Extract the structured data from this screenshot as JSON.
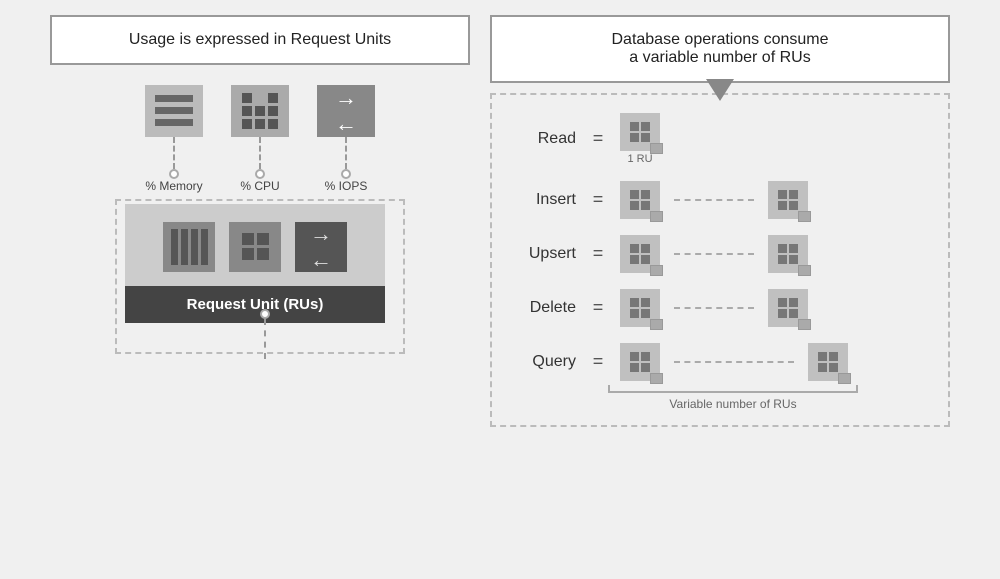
{
  "left": {
    "header": "Usage is expressed in Request Units",
    "resources": [
      {
        "id": "memory",
        "label": "% Memory"
      },
      {
        "id": "cpu",
        "label": "% CPU"
      },
      {
        "id": "iops",
        "label": "% IOPS"
      }
    ],
    "ru_label": "Request Unit (RUs)"
  },
  "right": {
    "header_line1": "Database operations consume",
    "header_line2": "a variable number of RUs",
    "operations": [
      {
        "id": "read",
        "label": "Read",
        "eq": "=",
        "units": 1,
        "ru_label": "1 RU",
        "variable": false
      },
      {
        "id": "insert",
        "label": "Insert",
        "eq": "=",
        "units": 2,
        "ru_label": "",
        "variable": false
      },
      {
        "id": "upsert",
        "label": "Upsert",
        "eq": "=",
        "units": 2,
        "ru_label": "",
        "variable": false
      },
      {
        "id": "delete",
        "label": "Delete",
        "eq": "=",
        "units": 2,
        "ru_label": "",
        "variable": false
      },
      {
        "id": "query",
        "label": "Query",
        "eq": "=",
        "units": 2,
        "ru_label": "",
        "variable": true
      }
    ],
    "variable_label": "Variable number of RUs"
  }
}
